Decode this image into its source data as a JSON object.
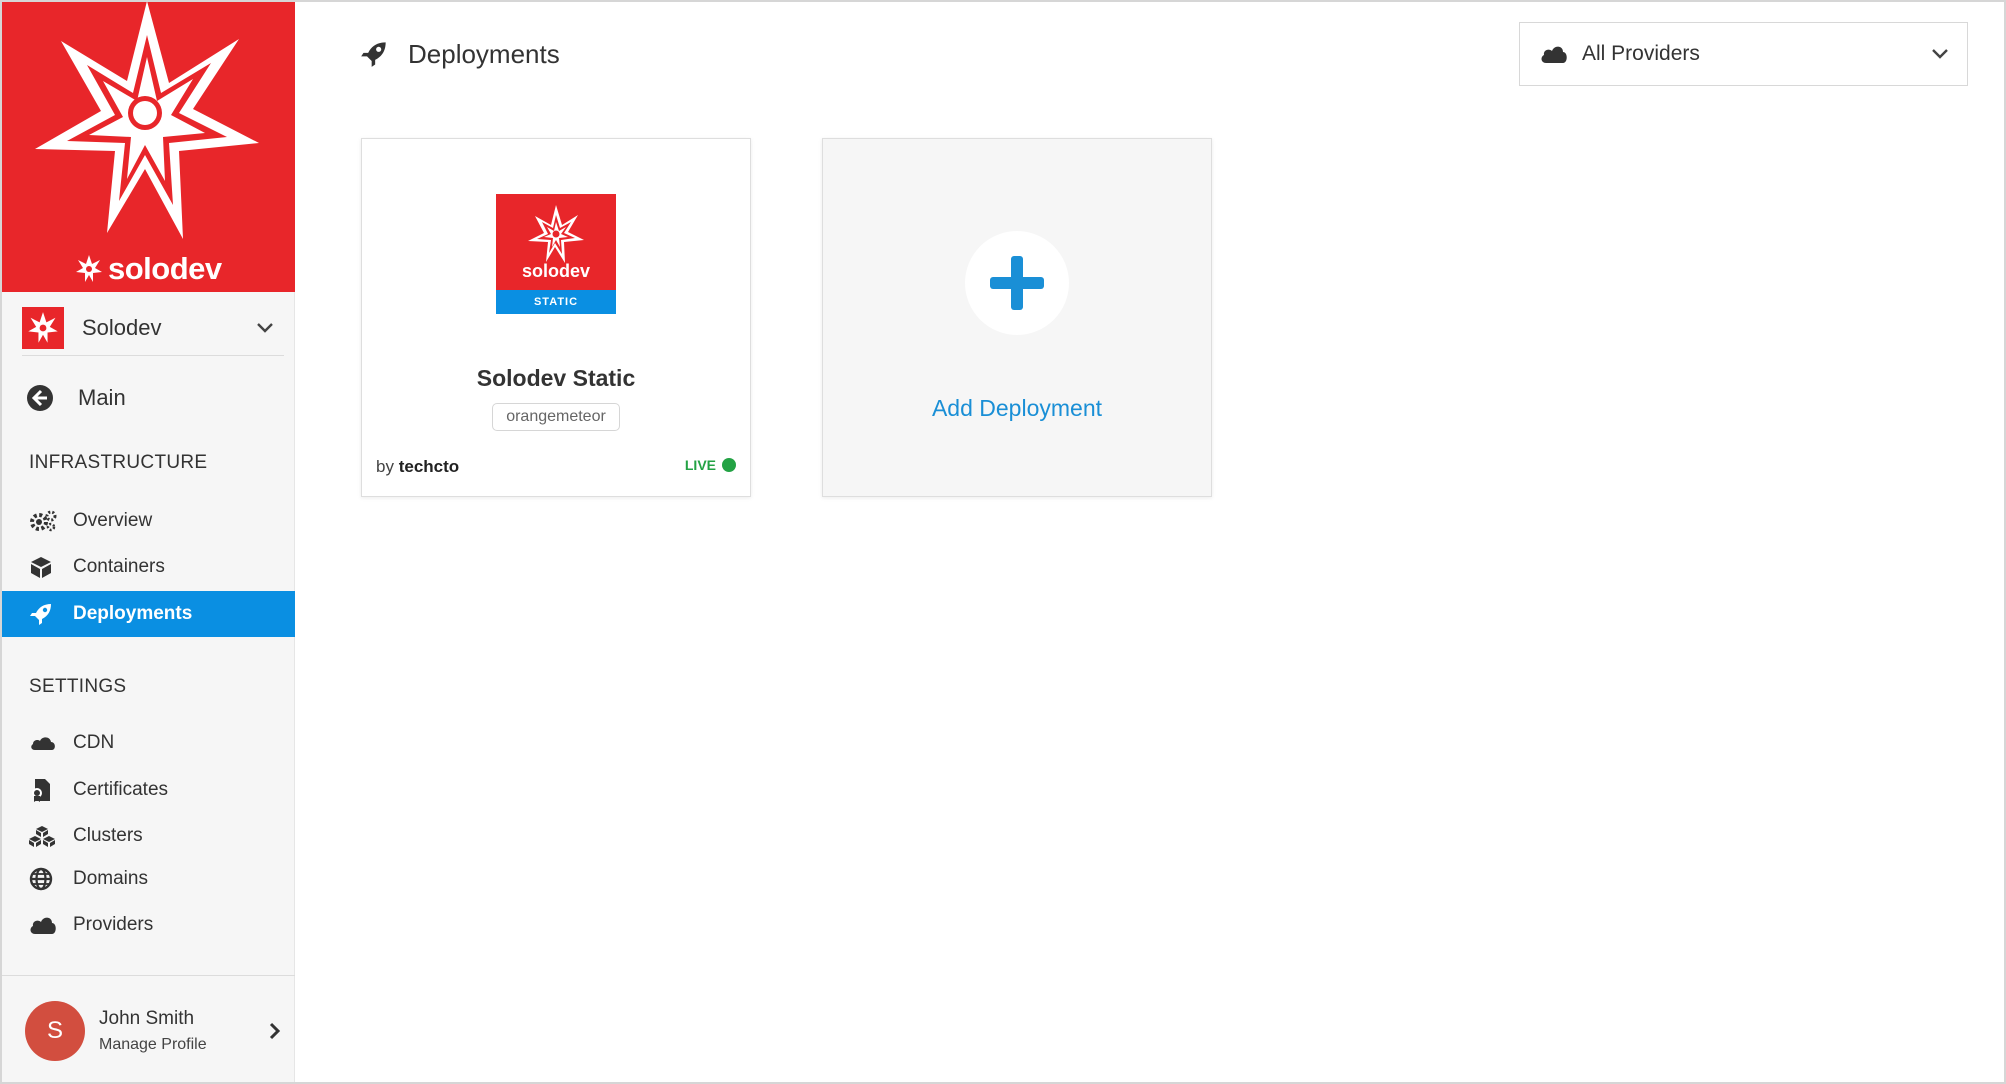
{
  "brand": {
    "wordmark": "solodev"
  },
  "org": {
    "name": "Solodev"
  },
  "nav": {
    "main_label": "Main",
    "infrastructure_title": "INFRASTRUCTURE",
    "infrastructure": [
      {
        "label": "Overview",
        "icon": "cogs-icon"
      },
      {
        "label": "Containers",
        "icon": "cube-icon"
      },
      {
        "label": "Deployments",
        "icon": "rocket-icon",
        "active": true
      }
    ],
    "settings_title": "SETTINGS",
    "settings": [
      {
        "label": "CDN",
        "icon": "cloud-icon"
      },
      {
        "label": "Certificates",
        "icon": "certificate-icon"
      },
      {
        "label": "Clusters",
        "icon": "cubes-icon"
      },
      {
        "label": "Domains",
        "icon": "globe-icon"
      },
      {
        "label": "Providers",
        "icon": "cloud-solid-icon"
      }
    ]
  },
  "profile": {
    "initial": "S",
    "name": "John Smith",
    "subtitle": "Manage Profile"
  },
  "header": {
    "title": "Deployments"
  },
  "provider_filter": {
    "selected": "All Providers"
  },
  "deployments": [
    {
      "logo_word": "solodev",
      "logo_band": "STATIC",
      "name": "Solodev Static",
      "tag": "orangemeteor",
      "by_prefix": "by",
      "author": "techcto",
      "status": "LIVE"
    }
  ],
  "add_card": {
    "label": "Add Deployment"
  },
  "colors": {
    "brand_red": "#e8262a",
    "accent_blue": "#0a8fe2",
    "live_green": "#23a244",
    "avatar": "#d24e3f"
  }
}
